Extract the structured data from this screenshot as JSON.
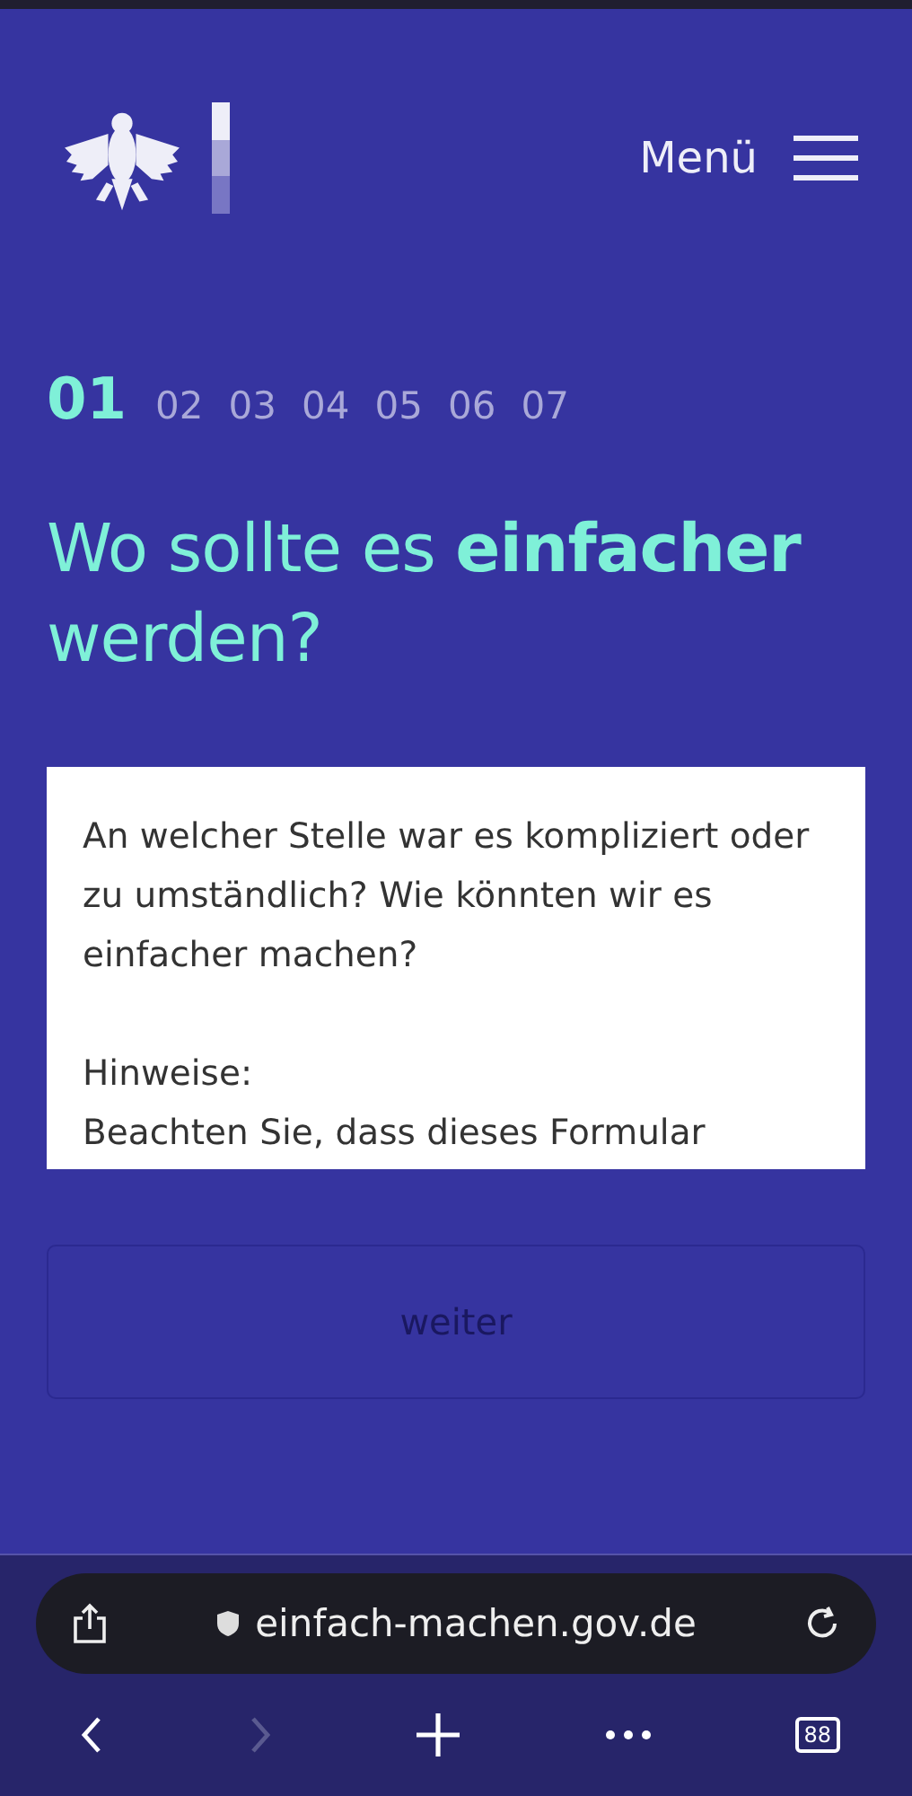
{
  "header": {
    "menu_label": "Menü"
  },
  "steps": [
    {
      "label": "01",
      "selected": true
    },
    {
      "label": "02",
      "selected": false
    },
    {
      "label": "03",
      "selected": false
    },
    {
      "label": "04",
      "selected": false
    },
    {
      "label": "05",
      "selected": false
    },
    {
      "label": "06",
      "selected": false
    },
    {
      "label": "07",
      "selected": false
    }
  ],
  "question": "Wo sollte es **einfacher** werden?",
  "answer_field": {
    "placeholder": "An welcher Stelle war es kompliziert oder zu umständlich? Wie könnten wir es einfacher machen?\n\nHinweise:\nBeachten Sie, dass dieses Formular"
  },
  "next_button": {
    "label": "weiter",
    "disabled": true
  },
  "browser": {
    "url": "einfach-machen.gov.de",
    "tab_count": "88",
    "forward_disabled": true
  }
}
